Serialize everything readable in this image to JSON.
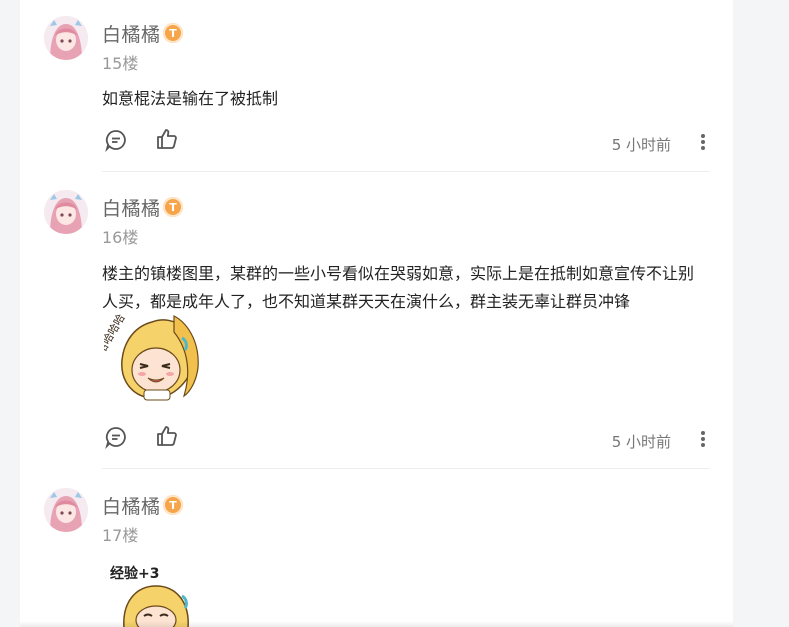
{
  "comments": [
    {
      "username": "白橘橘",
      "badge": "T",
      "floor": "15楼",
      "text": "如意棍法是输在了被抵制",
      "time": "5 小时前"
    },
    {
      "username": "白橘橘",
      "badge": "T",
      "floor": "16楼",
      "text": "楼主的镇楼图里，某群的一些小号看似在哭弱如意，实际上是在抵制如意宣传不让别人买，都是成年人了，也不知道某群天天在演什么，群主装无辜让群员冲锋",
      "sticker_text": "哈哈哈哈",
      "time": "5 小时前"
    },
    {
      "username": "白橘橘",
      "badge": "T",
      "floor": "17楼",
      "sticker_text": "经验+3"
    }
  ],
  "icons": {
    "comment": "comment-bubble-icon",
    "like": "thumbs-up-icon",
    "more": "more-vertical-icon"
  },
  "colors": {
    "badge": "#f7a54a",
    "page_bg": "#f4f5f7"
  }
}
